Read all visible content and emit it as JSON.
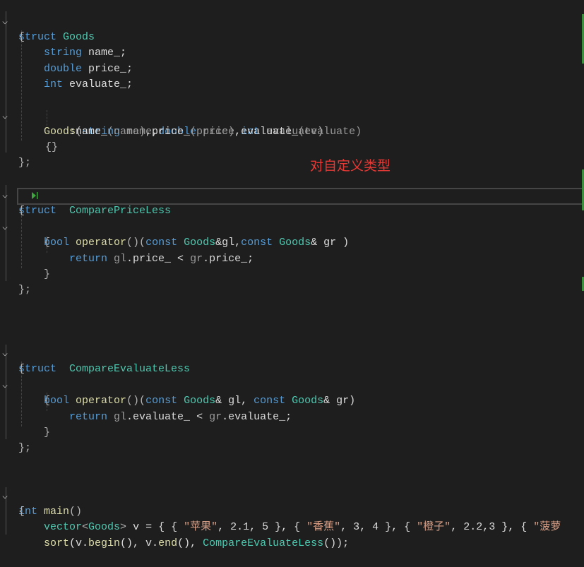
{
  "annotation": "对自定义类型",
  "colors": {
    "background": "#1e1e1e",
    "keyword": "#569cd6",
    "type": "#4ec9b0",
    "function": "#dcdcaa",
    "string": "#d69d85",
    "annotation": "#e53935"
  },
  "code": {
    "l1": {
      "kw": "struct",
      "name": "Goods"
    },
    "l2": "{",
    "l3": {
      "type": "string",
      "name": "name_;"
    },
    "l4": {
      "type": "double",
      "name": "price_;"
    },
    "l5": {
      "type": "int",
      "name": "evaluate_;"
    },
    "l7": {
      "ctor": "Goods",
      "p1": "string",
      "n1": "name",
      "p2": "double",
      "n2": "price",
      "p3": "int",
      "n3": "evaluate"
    },
    "l8": {
      "a": ":name_",
      "b": "(name)",
      "c": ",price_",
      "d": "(price)",
      "e": ",evaluate_",
      "f": "(evaluate)"
    },
    "l9": "{}",
    "l10": "};",
    "l12": {
      "kw": "struct",
      "name": "ComparePriceLess"
    },
    "l13": "{",
    "l14": {
      "bool": "bool",
      "op": "operator",
      "paren": "()(",
      "c1": "const",
      "g1": "Goods",
      "gl": "&gl,",
      "c2": "const",
      "g2": "Goods",
      "gr": "& gr )"
    },
    "l15": "{",
    "l16": {
      "ret": "return",
      "lhs": "gl",
      "a": ".price_ < ",
      "rhs": "gr",
      "b": ".price_;"
    },
    "l17": "}",
    "l18": "};",
    "l22": {
      "kw": "struct",
      "name": "CompareEvaluateLess"
    },
    "l23": "{",
    "l24": {
      "bool": "bool",
      "op": "operator",
      "paren": "()(",
      "c1": "const",
      "g1": "Goods",
      "gl": "& gl, ",
      "c2": "const",
      "g2": "Goods",
      "gr": "& gr)"
    },
    "l25": "{",
    "l26": {
      "ret": "return",
      "lhs": "gl",
      "a": ".evaluate_ < ",
      "rhs": "gr",
      "b": ".evaluate_;"
    },
    "l27": "}",
    "l28": "};",
    "l31": {
      "int": "int",
      "main": "main",
      "paren": "()"
    },
    "l32": "{",
    "l33": {
      "vec": "vector",
      "lt": "<",
      "goods": "Goods",
      "gt": ">",
      "v": " v = { { ",
      "s1": "\"苹果\"",
      "n1": ", 2.1, 5 }, { ",
      "s2": "\"香蕉\"",
      "n2": ", 3, 4 }, { ",
      "s3": "\"橙子\"",
      "n3": ", 2.2,3 }, { ",
      "s4": "\"菠萝"
    },
    "l34": {
      "sort": "sort",
      "a": "(v.",
      "begin": "begin",
      "b": "(), v.",
      "end": "end",
      "c": "(), ",
      "cmp": "CompareEvaluateLess",
      "d": "());"
    }
  }
}
